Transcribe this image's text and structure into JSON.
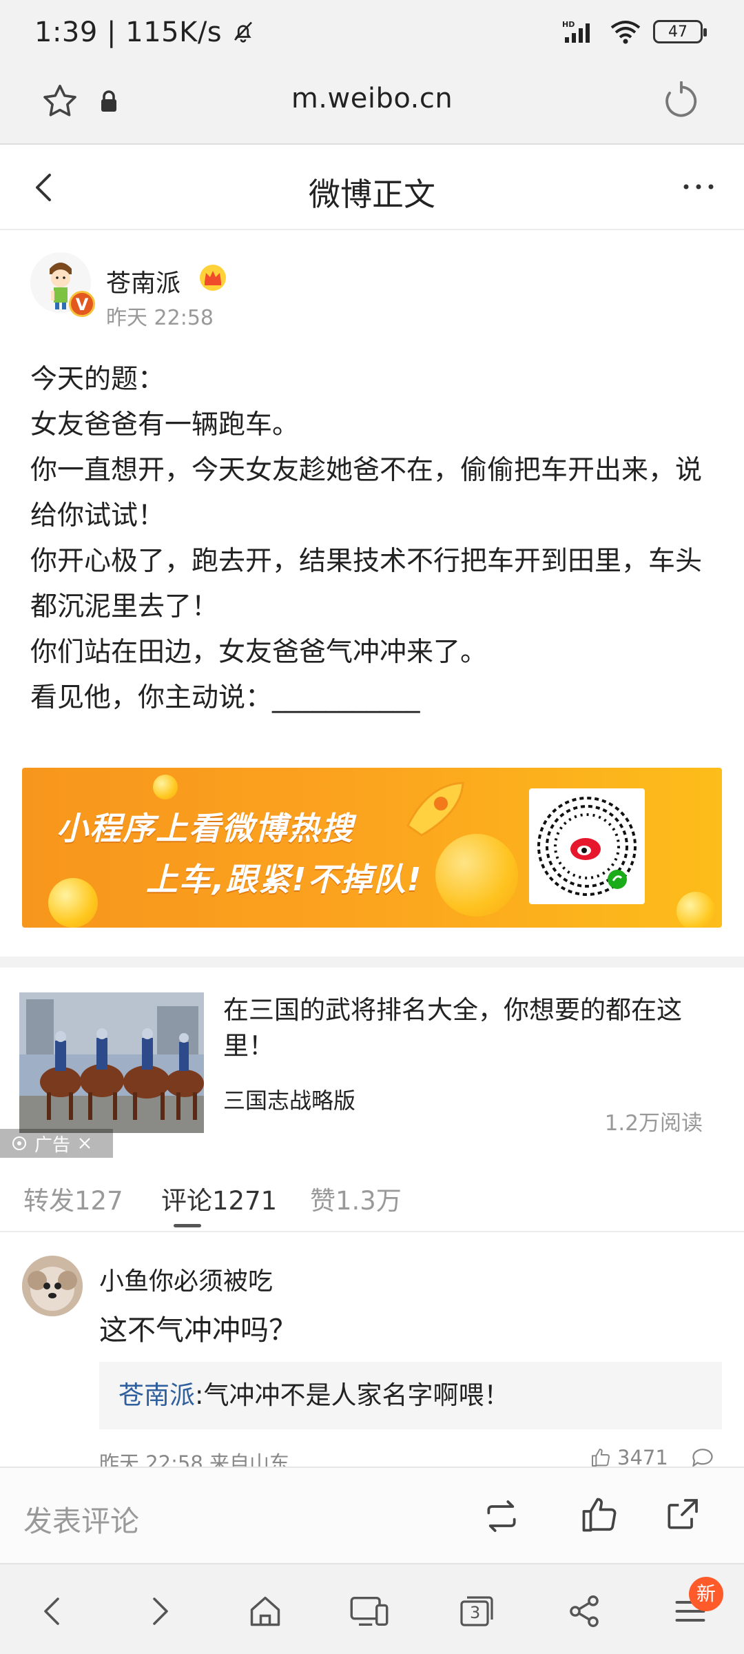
{
  "status_bar": {
    "time": "1:39",
    "separator": "|",
    "speed": "115K/s",
    "network": "HD",
    "battery": "47"
  },
  "browser": {
    "url": "m.weibo.cn"
  },
  "header": {
    "title": "微博正文"
  },
  "post": {
    "author": "苍南派",
    "time": "昨天 22:58",
    "verified_badge": "V",
    "lines": [
      "今天的题：",
      "女友爸爸有一辆跑车。",
      "你一直想开，今天女友趁她爸不在，偷偷把车开出来，说给你试试！",
      "你开心极了，跑去开，结果技术不行把车开到田里，车头都沉泥里去了！",
      "你们站在田边，女友爸爸气冲冲来了。",
      "看见他，你主动说：___________"
    ]
  },
  "banner": {
    "line1": "小程序上看微博热搜",
    "line2": "上车,跟紧!不掉队!"
  },
  "ad": {
    "title": "在三国的武将排名大全，你想要的都在这里！",
    "source": "三国志战略版",
    "reads": "1.2万阅读",
    "badge": "广告"
  },
  "tabs": [
    {
      "label": "转发127"
    },
    {
      "label": "评论1271"
    },
    {
      "label": "赞1.3万"
    }
  ],
  "comment": {
    "user": "小鱼你必须被吃",
    "text": "这不气冲冲吗？",
    "reply_author": "苍南派",
    "reply_text": ":气冲冲不是人家名字啊喂！",
    "meta": "昨天 22:58 来自山东",
    "likes": "3471"
  },
  "comment_bar": {
    "placeholder": "发表评论"
  },
  "browser_nav": {
    "tab_count": "3",
    "new_badge": "新"
  },
  "colors": {
    "link_blue": "#2f5f9c",
    "banner_orange": "#f7961c",
    "badge_red": "#ff5a2a"
  }
}
